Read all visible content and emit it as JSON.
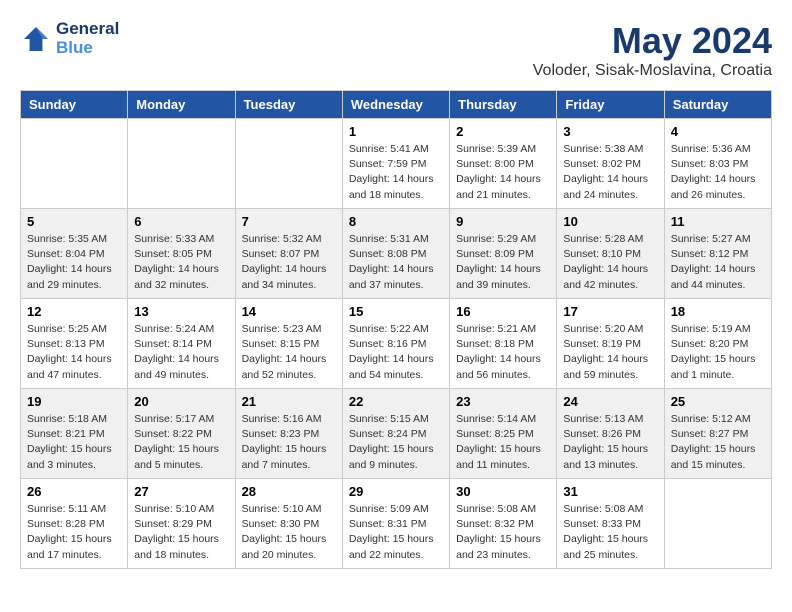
{
  "header": {
    "logo_line1": "General",
    "logo_line2": "Blue",
    "month": "May 2024",
    "location": "Voloder, Sisak-Moslavina, Croatia"
  },
  "days_of_week": [
    "Sunday",
    "Monday",
    "Tuesday",
    "Wednesday",
    "Thursday",
    "Friday",
    "Saturday"
  ],
  "weeks": [
    [
      {
        "day": "",
        "info": ""
      },
      {
        "day": "",
        "info": ""
      },
      {
        "day": "",
        "info": ""
      },
      {
        "day": "1",
        "info": "Sunrise: 5:41 AM\nSunset: 7:59 PM\nDaylight: 14 hours\nand 18 minutes."
      },
      {
        "day": "2",
        "info": "Sunrise: 5:39 AM\nSunset: 8:00 PM\nDaylight: 14 hours\nand 21 minutes."
      },
      {
        "day": "3",
        "info": "Sunrise: 5:38 AM\nSunset: 8:02 PM\nDaylight: 14 hours\nand 24 minutes."
      },
      {
        "day": "4",
        "info": "Sunrise: 5:36 AM\nSunset: 8:03 PM\nDaylight: 14 hours\nand 26 minutes."
      }
    ],
    [
      {
        "day": "5",
        "info": "Sunrise: 5:35 AM\nSunset: 8:04 PM\nDaylight: 14 hours\nand 29 minutes."
      },
      {
        "day": "6",
        "info": "Sunrise: 5:33 AM\nSunset: 8:05 PM\nDaylight: 14 hours\nand 32 minutes."
      },
      {
        "day": "7",
        "info": "Sunrise: 5:32 AM\nSunset: 8:07 PM\nDaylight: 14 hours\nand 34 minutes."
      },
      {
        "day": "8",
        "info": "Sunrise: 5:31 AM\nSunset: 8:08 PM\nDaylight: 14 hours\nand 37 minutes."
      },
      {
        "day": "9",
        "info": "Sunrise: 5:29 AM\nSunset: 8:09 PM\nDaylight: 14 hours\nand 39 minutes."
      },
      {
        "day": "10",
        "info": "Sunrise: 5:28 AM\nSunset: 8:10 PM\nDaylight: 14 hours\nand 42 minutes."
      },
      {
        "day": "11",
        "info": "Sunrise: 5:27 AM\nSunset: 8:12 PM\nDaylight: 14 hours\nand 44 minutes."
      }
    ],
    [
      {
        "day": "12",
        "info": "Sunrise: 5:25 AM\nSunset: 8:13 PM\nDaylight: 14 hours\nand 47 minutes."
      },
      {
        "day": "13",
        "info": "Sunrise: 5:24 AM\nSunset: 8:14 PM\nDaylight: 14 hours\nand 49 minutes."
      },
      {
        "day": "14",
        "info": "Sunrise: 5:23 AM\nSunset: 8:15 PM\nDaylight: 14 hours\nand 52 minutes."
      },
      {
        "day": "15",
        "info": "Sunrise: 5:22 AM\nSunset: 8:16 PM\nDaylight: 14 hours\nand 54 minutes."
      },
      {
        "day": "16",
        "info": "Sunrise: 5:21 AM\nSunset: 8:18 PM\nDaylight: 14 hours\nand 56 minutes."
      },
      {
        "day": "17",
        "info": "Sunrise: 5:20 AM\nSunset: 8:19 PM\nDaylight: 14 hours\nand 59 minutes."
      },
      {
        "day": "18",
        "info": "Sunrise: 5:19 AM\nSunset: 8:20 PM\nDaylight: 15 hours\nand 1 minute."
      }
    ],
    [
      {
        "day": "19",
        "info": "Sunrise: 5:18 AM\nSunset: 8:21 PM\nDaylight: 15 hours\nand 3 minutes."
      },
      {
        "day": "20",
        "info": "Sunrise: 5:17 AM\nSunset: 8:22 PM\nDaylight: 15 hours\nand 5 minutes."
      },
      {
        "day": "21",
        "info": "Sunrise: 5:16 AM\nSunset: 8:23 PM\nDaylight: 15 hours\nand 7 minutes."
      },
      {
        "day": "22",
        "info": "Sunrise: 5:15 AM\nSunset: 8:24 PM\nDaylight: 15 hours\nand 9 minutes."
      },
      {
        "day": "23",
        "info": "Sunrise: 5:14 AM\nSunset: 8:25 PM\nDaylight: 15 hours\nand 11 minutes."
      },
      {
        "day": "24",
        "info": "Sunrise: 5:13 AM\nSunset: 8:26 PM\nDaylight: 15 hours\nand 13 minutes."
      },
      {
        "day": "25",
        "info": "Sunrise: 5:12 AM\nSunset: 8:27 PM\nDaylight: 15 hours\nand 15 minutes."
      }
    ],
    [
      {
        "day": "26",
        "info": "Sunrise: 5:11 AM\nSunset: 8:28 PM\nDaylight: 15 hours\nand 17 minutes."
      },
      {
        "day": "27",
        "info": "Sunrise: 5:10 AM\nSunset: 8:29 PM\nDaylight: 15 hours\nand 18 minutes."
      },
      {
        "day": "28",
        "info": "Sunrise: 5:10 AM\nSunset: 8:30 PM\nDaylight: 15 hours\nand 20 minutes."
      },
      {
        "day": "29",
        "info": "Sunrise: 5:09 AM\nSunset: 8:31 PM\nDaylight: 15 hours\nand 22 minutes."
      },
      {
        "day": "30",
        "info": "Sunrise: 5:08 AM\nSunset: 8:32 PM\nDaylight: 15 hours\nand 23 minutes."
      },
      {
        "day": "31",
        "info": "Sunrise: 5:08 AM\nSunset: 8:33 PM\nDaylight: 15 hours\nand 25 minutes."
      },
      {
        "day": "",
        "info": ""
      }
    ]
  ]
}
